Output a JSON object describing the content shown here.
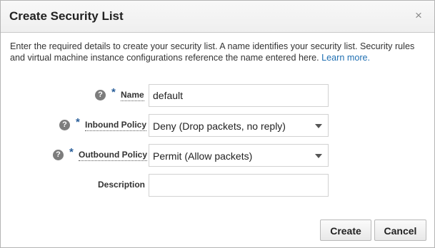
{
  "dialog": {
    "title": "Create Security List",
    "close_label": "×"
  },
  "intro": {
    "text": "Enter the required details to create your security list. A name identifies your security list. Security rules and virtual machine instance configurations reference the name entered here.",
    "link_label": "Learn more."
  },
  "fields": {
    "name": {
      "label": "Name",
      "required": "*",
      "help": "?",
      "value": "default"
    },
    "inbound_policy": {
      "label": "Inbound Policy",
      "required": "*",
      "help": "?",
      "selected": "Deny (Drop packets, no reply)"
    },
    "outbound_policy": {
      "label": "Outbound Policy",
      "required": "*",
      "help": "?",
      "selected": "Permit (Allow packets)"
    },
    "description": {
      "label": "Description",
      "value": ""
    }
  },
  "buttons": {
    "create_label": "Create",
    "cancel_label": "Cancel"
  },
  "icons": {
    "help": "help-icon",
    "close": "close-icon",
    "dropdown": "chevron-down-icon"
  },
  "colors": {
    "link": "#1f6fb2",
    "required_star": "#2a5f9a",
    "help_icon_bg": "#7d7d7d"
  }
}
